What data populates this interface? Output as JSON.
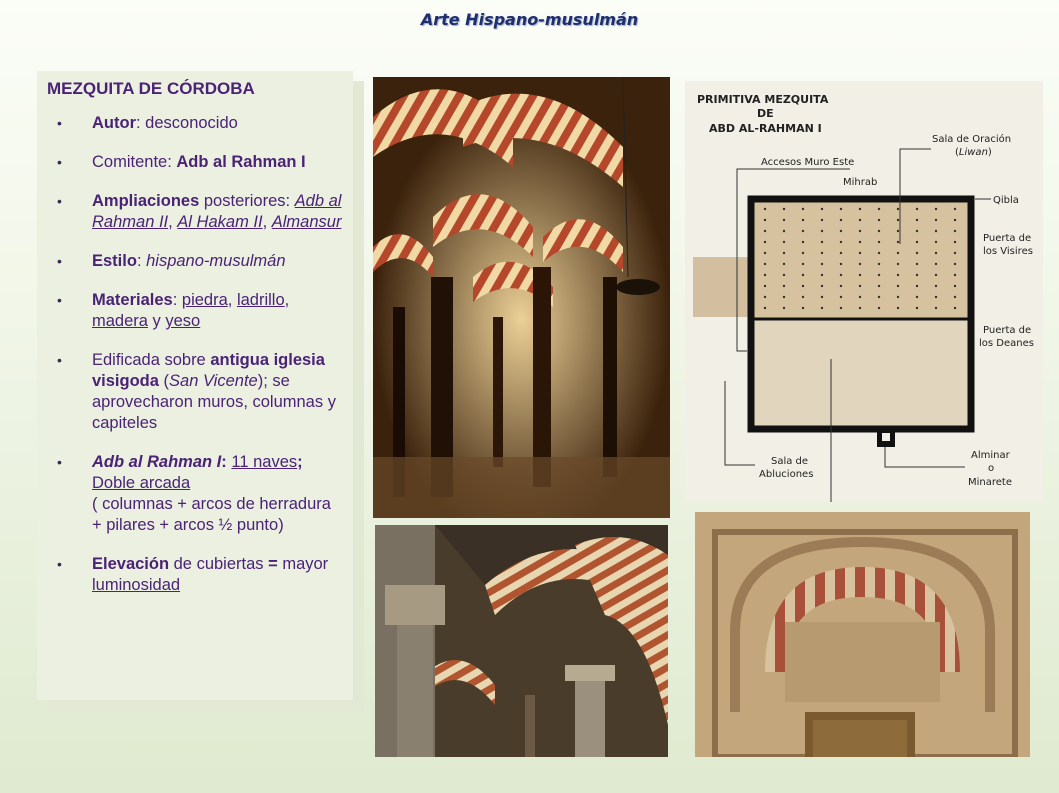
{
  "header": {
    "title": "Arte Hispano-musulmán"
  },
  "panel": {
    "heading": "MEZQUITA DE CÓRDOBA",
    "autor": {
      "label": "Autor",
      "value": ": desconocido"
    },
    "comitente": {
      "label": "Comitente: ",
      "value": "Adb al Rahman I"
    },
    "ampliaciones": {
      "label": "Ampliaciones",
      "text": " posteriores: ",
      "links": [
        "Adb al Rahman II",
        "Al Hakam II",
        "Almansur"
      ],
      "sep": ", "
    },
    "estilo": {
      "label": "Estilo",
      "sep": ": ",
      "value": "hispano-musulmán"
    },
    "materiales": {
      "label": "Materiales",
      "sep": ":  ",
      "items": [
        "piedra",
        "ladrillo",
        "madera",
        "yeso"
      ],
      "y": " y "
    },
    "edificada": {
      "pre": "Edificada sobre ",
      "bold": "antigua iglesia visigoda",
      "open": " (",
      "italic": "San Vicente",
      "post": "); se aprovecharon muros, columnas y capiteles"
    },
    "naves": {
      "bold_italic": "Adb al Rahman I",
      "colon": ": ",
      "link1": "11 naves",
      "semi": "; ",
      "link2": "Doble arcada",
      "post": "( columnas + arcos de herradura + pilares + arcos ½ punto)"
    },
    "elevacion": {
      "label": "Elevación",
      "text": " de cubiertas ",
      "eq": "=",
      "post": " mayor ",
      "link": "luminosidad"
    }
  },
  "plan": {
    "title_line1": "PRIMITIVA MEZQUITA",
    "title_line2": "DE",
    "title_line3": "ABD AL-RAHMAN I",
    "sala_oracion": "Sala de Oración",
    "liwan_open": "(",
    "liwan": "Liwan",
    "liwan_close": ")",
    "accesos": "Accesos Muro Este",
    "mihrab": "Mihrab",
    "qibla": "Qibla",
    "visires_1": "Puerta de",
    "visires_2": "los Visires",
    "deanes_1": "Puerta de",
    "deanes_2": "los Deanes",
    "abluciones_1": "Sala de",
    "abluciones_2": "Abluciones",
    "alminar_1": "Alminar",
    "alminar_2": "o",
    "alminar_3": "Minarete"
  },
  "colors": {
    "heading_purple": "#4a2377",
    "title_blue": "#1f2f6e",
    "plan_fill": "#d9c4a4"
  }
}
